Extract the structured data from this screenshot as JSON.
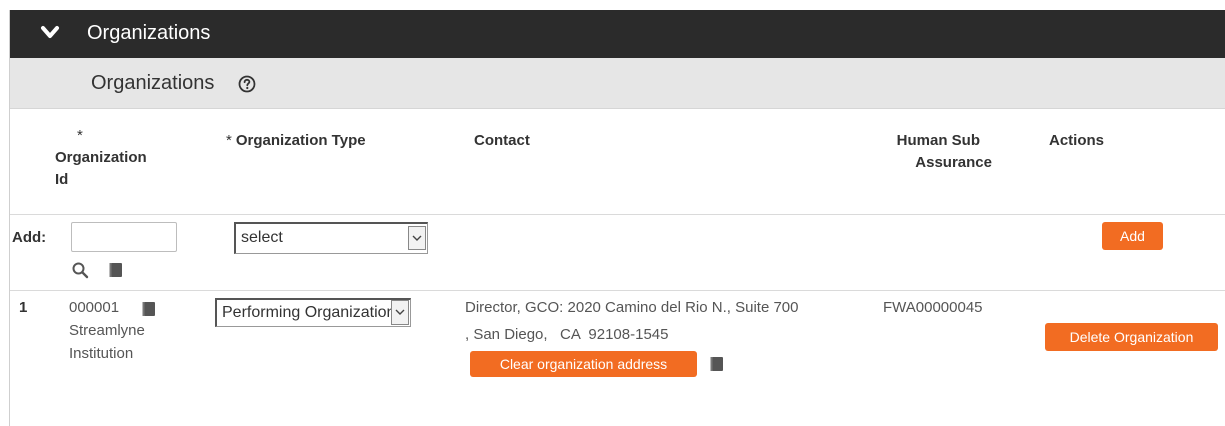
{
  "section": {
    "title": "Organizations"
  },
  "subsection": {
    "title": "Organizations"
  },
  "columns": {
    "org_id": {
      "required": "*",
      "label_line1": "Organization",
      "label_line2": "Id"
    },
    "org_type": {
      "required": "*",
      "label": "Organization Type"
    },
    "contact": {
      "label": "Contact"
    },
    "human_sub": {
      "label_line1": "Human Sub",
      "label_line2": "Assurance"
    },
    "actions": {
      "label": "Actions"
    }
  },
  "add_row": {
    "label": "Add:",
    "org_id_value": "",
    "org_type_selected": "select",
    "add_button": "Add"
  },
  "rows": [
    {
      "index": "1",
      "org_id": "000001",
      "org_name_line1": "Streamlyne",
      "org_name_line2": "Institution",
      "org_type_selected": "Performing Organization",
      "contact_line1": "Director, GCO: 2020 Camino del Rio N., Suite 700",
      "contact_line2": ", San Diego,   CA  92108-1545",
      "clear_address_button": "Clear organization address",
      "human_sub_assurance": "FWA00000045",
      "delete_button": "Delete Organization"
    }
  ],
  "colors": {
    "header_bg": "#2b2b2b",
    "subheader_bg": "#e6e6e6",
    "accent": "#f26c22"
  },
  "icons": [
    "chevron-down-icon",
    "help-icon",
    "search-icon",
    "document-icon",
    "dropdown-arrow-icon"
  ]
}
